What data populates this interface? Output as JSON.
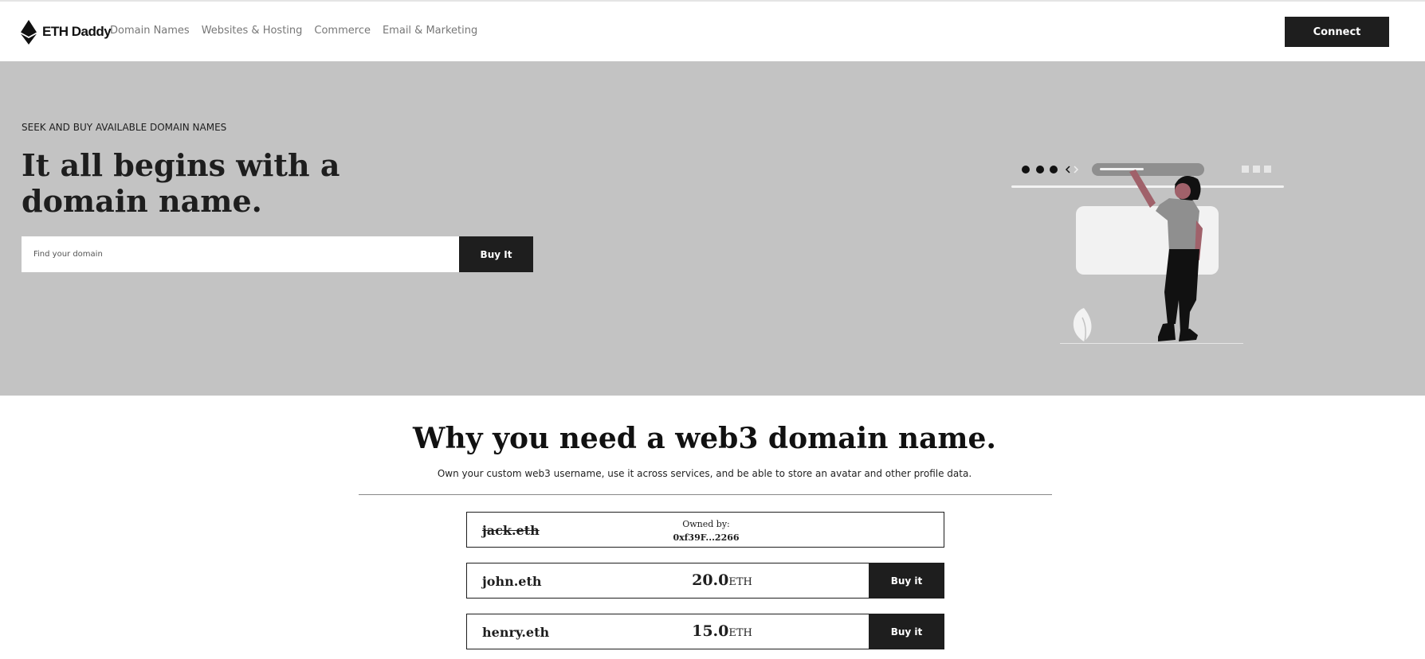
{
  "nav": {
    "brand": "ETH Daddy",
    "links": [
      "Domain Names",
      "Websites & Hosting",
      "Commerce",
      "Email & Marketing"
    ],
    "connect_label": "Connect"
  },
  "hero": {
    "eyebrow": "SEEK AND BUY AVAILABLE DOMAIN NAMES",
    "title": "It all begins with a domain name.",
    "search_placeholder": "Find your domain",
    "buy_label": "Buy It"
  },
  "section": {
    "title": "Why you need a web3 domain name.",
    "subtitle": "Own your custom web3 username, use it across services, and be able to store an avatar and other profile data."
  },
  "domains": [
    {
      "name": "jack.eth",
      "owned_label": "Owned by:",
      "owner": "0xf39F...2266"
    },
    {
      "name": "john.eth",
      "price": "20.0",
      "currency": "ETH",
      "buy_label": "Buy it"
    },
    {
      "name": "henry.eth",
      "price": "15.0",
      "currency": "ETH",
      "buy_label": "Buy it"
    }
  ],
  "colors": {
    "hero_bg": "#c3c3c3",
    "button_bg": "#1e1e1e",
    "accent_arm": "#a0616a"
  },
  "icons": {
    "brand": "ethereum-logo-icon"
  }
}
